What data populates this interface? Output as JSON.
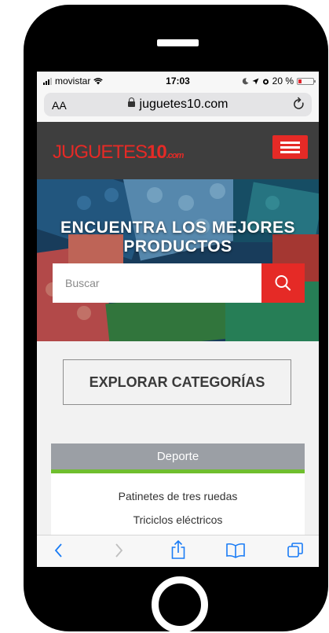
{
  "status_bar": {
    "carrier": "movistar",
    "time": "17:03",
    "battery": "20 %"
  },
  "browser": {
    "aa_label": "AA",
    "url": "juguetes10.com"
  },
  "site": {
    "logo_main": "JUGUETES",
    "logo_num": "10",
    "logo_suffix": ".com",
    "brand_color": "#e52a26"
  },
  "hero": {
    "title_line1": "ENCUENTRA LOS MEJORES",
    "title_line2": "PRODUCTOS",
    "search_placeholder": "Buscar"
  },
  "explore_label": "EXPLORAR CATEGORÍAS",
  "category": {
    "title": "Deporte",
    "accent_color": "#6fbe2e",
    "items": [
      "Patinetes de tres ruedas",
      "Triciclos eléctricos"
    ]
  },
  "icons": {
    "back": "chevron-left-icon",
    "forward": "chevron-right-icon",
    "share": "share-icon",
    "bookmarks": "book-icon",
    "tabs": "tabs-icon",
    "search": "search-icon",
    "menu": "hamburger-icon",
    "reload": "reload-icon",
    "lock": "lock-icon"
  }
}
